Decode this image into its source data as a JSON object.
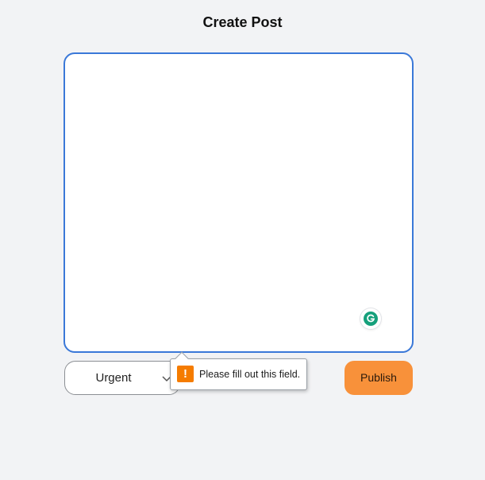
{
  "page": {
    "title": "Create Post"
  },
  "editor": {
    "value": "",
    "placeholder": ""
  },
  "grammarly": {
    "icon": "grammarly-icon"
  },
  "priority": {
    "selected": "Urgent",
    "icon": "chevron-down-icon"
  },
  "publish": {
    "label": "Publish"
  },
  "validation": {
    "message": "Please fill out this field.",
    "icon_glyph": "!",
    "icon": "warning-icon"
  },
  "colors": {
    "background": "#f2f3f5",
    "editor_border": "#3a78d8",
    "publish_button": "#f8913a",
    "warning": "#f57c00",
    "grammarly": "#15a07b"
  }
}
